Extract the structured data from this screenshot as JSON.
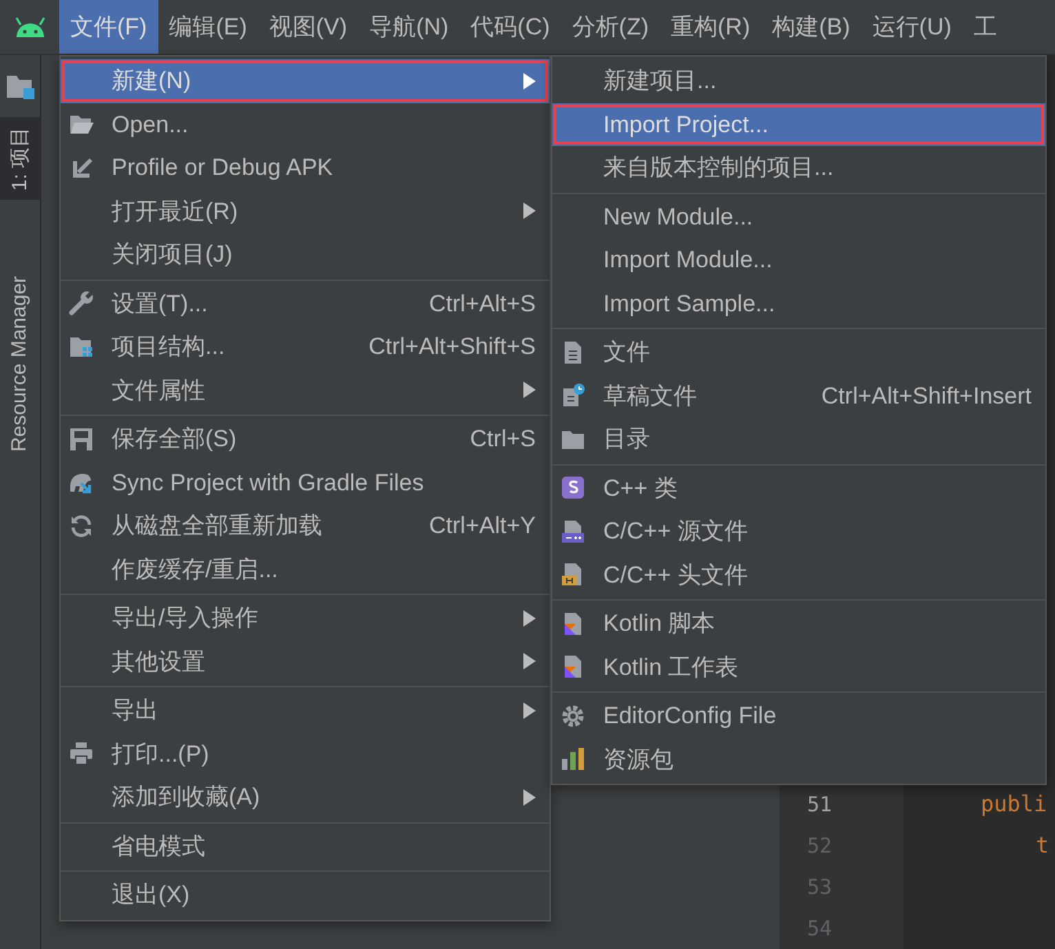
{
  "menubar": [
    {
      "label": "文件(F)",
      "selected": true
    },
    {
      "label": "编辑(E)",
      "selected": false
    },
    {
      "label": "视图(V)",
      "selected": false
    },
    {
      "label": "导航(N)",
      "selected": false
    },
    {
      "label": "代码(C)",
      "selected": false
    },
    {
      "label": "分析(Z)",
      "selected": false
    },
    {
      "label": "重构(R)",
      "selected": false
    },
    {
      "label": "构建(B)",
      "selected": false
    },
    {
      "label": "运行(U)",
      "selected": false
    },
    {
      "label": "工",
      "selected": false
    }
  ],
  "tool_tabs": [
    {
      "label": "1: 项目",
      "selected": true
    },
    {
      "label": "Resource Manager",
      "selected": false
    }
  ],
  "file_menu": [
    {
      "kind": "item",
      "label": "新建(N)",
      "submenu": true,
      "selected": true,
      "outlined": true
    },
    {
      "kind": "item",
      "label": "Open...",
      "submenu": false,
      "selected": false,
      "outlined": false
    },
    {
      "kind": "item",
      "label": "Profile or Debug APK",
      "submenu": false,
      "selected": false,
      "outlined": false
    },
    {
      "kind": "item",
      "label": "打开最近(R)",
      "submenu": true,
      "selected": false,
      "outlined": false
    },
    {
      "kind": "item",
      "label": "关闭项目(J)",
      "submenu": false,
      "selected": false,
      "outlined": false
    },
    {
      "kind": "separator"
    },
    {
      "kind": "item",
      "label": "设置(T)...",
      "shortcut": "Ctrl+Alt+S",
      "submenu": false,
      "selected": false,
      "outlined": false
    },
    {
      "kind": "item",
      "label": "项目结构...",
      "shortcut": "Ctrl+Alt+Shift+S",
      "submenu": false,
      "selected": false,
      "outlined": false
    },
    {
      "kind": "item",
      "label": "文件属性",
      "submenu": true,
      "selected": false,
      "outlined": false
    },
    {
      "kind": "separator"
    },
    {
      "kind": "item",
      "label": "保存全部(S)",
      "shortcut": "Ctrl+S",
      "submenu": false,
      "selected": false,
      "outlined": false
    },
    {
      "kind": "item",
      "label": "Sync Project with Gradle Files",
      "submenu": false,
      "selected": false,
      "outlined": false
    },
    {
      "kind": "item",
      "label": "从磁盘全部重新加载",
      "shortcut": "Ctrl+Alt+Y",
      "submenu": false,
      "selected": false,
      "outlined": false
    },
    {
      "kind": "item",
      "label": "作废缓存/重启...",
      "submenu": false,
      "selected": false,
      "outlined": false
    },
    {
      "kind": "separator"
    },
    {
      "kind": "item",
      "label": "导出/导入操作",
      "submenu": true,
      "selected": false,
      "outlined": false
    },
    {
      "kind": "item",
      "label": "其他设置",
      "submenu": true,
      "selected": false,
      "outlined": false
    },
    {
      "kind": "separator"
    },
    {
      "kind": "item",
      "label": "导出",
      "submenu": true,
      "selected": false,
      "outlined": false
    },
    {
      "kind": "item",
      "label": "打印...(P)",
      "submenu": false,
      "selected": false,
      "outlined": false
    },
    {
      "kind": "item",
      "label": "添加到收藏(A)",
      "submenu": true,
      "selected": false,
      "outlined": false
    },
    {
      "kind": "separator"
    },
    {
      "kind": "item",
      "label": "省电模式",
      "submenu": false,
      "selected": false,
      "outlined": false
    },
    {
      "kind": "separator"
    },
    {
      "kind": "item",
      "label": "退出(X)",
      "submenu": false,
      "selected": false,
      "outlined": false
    }
  ],
  "new_submenu": [
    {
      "kind": "item",
      "label": "新建项目...",
      "submenu": false,
      "selected": false,
      "outlined": false
    },
    {
      "kind": "item",
      "label": "Import Project...",
      "submenu": false,
      "selected": true,
      "outlined": true
    },
    {
      "kind": "item",
      "label": "来自版本控制的项目...",
      "submenu": false,
      "selected": false,
      "outlined": false
    },
    {
      "kind": "separator"
    },
    {
      "kind": "item",
      "label": "New Module...",
      "submenu": false,
      "selected": false,
      "outlined": false
    },
    {
      "kind": "item",
      "label": "Import Module...",
      "submenu": false,
      "selected": false,
      "outlined": false
    },
    {
      "kind": "item",
      "label": "Import Sample...",
      "submenu": false,
      "selected": false,
      "outlined": false
    },
    {
      "kind": "separator"
    },
    {
      "kind": "item",
      "label": "文件",
      "submenu": false,
      "selected": false,
      "outlined": false
    },
    {
      "kind": "item",
      "label": "草稿文件",
      "shortcut": "Ctrl+Alt+Shift+Insert",
      "submenu": false,
      "selected": false,
      "outlined": false
    },
    {
      "kind": "item",
      "label": "目录",
      "submenu": false,
      "selected": false,
      "outlined": false
    },
    {
      "kind": "separator"
    },
    {
      "kind": "item",
      "label": "C++ 类",
      "submenu": false,
      "selected": false,
      "outlined": false
    },
    {
      "kind": "item",
      "label": "C/C++ 源文件",
      "submenu": false,
      "selected": false,
      "outlined": false
    },
    {
      "kind": "item",
      "label": "C/C++ 头文件",
      "submenu": false,
      "selected": false,
      "outlined": false
    },
    {
      "kind": "separator"
    },
    {
      "kind": "item",
      "label": "Kotlin 脚本",
      "submenu": false,
      "selected": false,
      "outlined": false
    },
    {
      "kind": "item",
      "label": "Kotlin 工作表",
      "submenu": false,
      "selected": false,
      "outlined": false
    },
    {
      "kind": "separator"
    },
    {
      "kind": "item",
      "label": "EditorConfig File",
      "submenu": false,
      "selected": false,
      "outlined": false
    },
    {
      "kind": "item",
      "label": "资源包",
      "submenu": false,
      "selected": false,
      "outlined": false
    }
  ],
  "editor": {
    "lines": [
      {
        "number": "51",
        "code": "publi"
      },
      {
        "number": "52",
        "code": "t"
      },
      {
        "number": "53"
      },
      {
        "number": "54"
      }
    ]
  }
}
